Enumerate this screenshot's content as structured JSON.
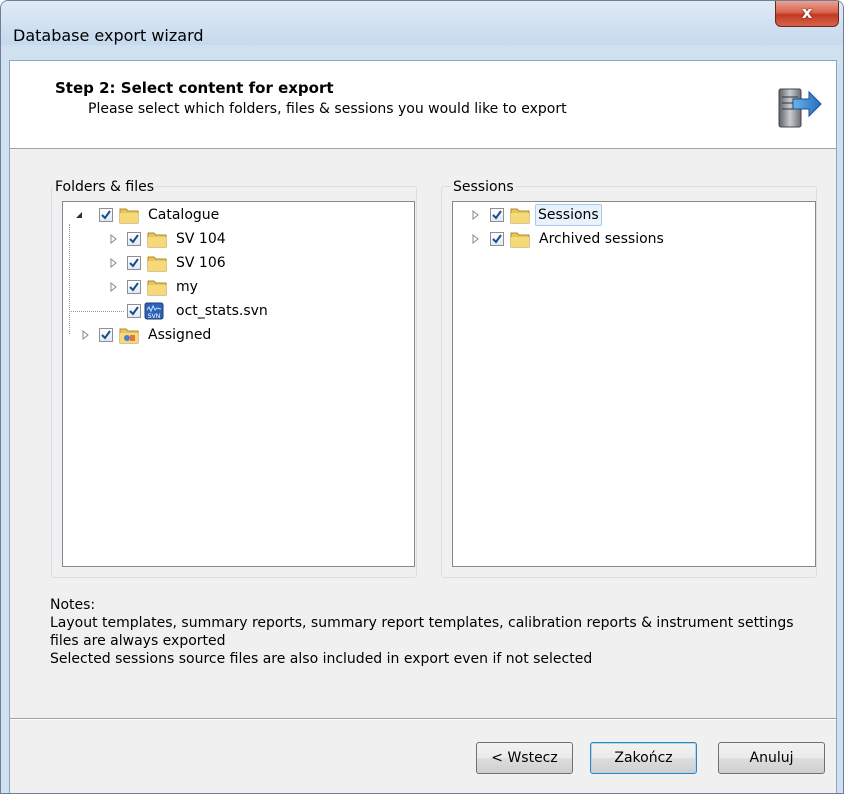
{
  "window": {
    "title": "Database export wizard",
    "close_glyph": "x"
  },
  "header": {
    "title": "Step 2: Select content for export",
    "subtitle": "Please select which folders, files & sessions you would like to export",
    "icon": "export-server-icon"
  },
  "folders_group": {
    "label": "Folders & files",
    "tree": [
      {
        "label": "Catalogue",
        "checked": true,
        "expanded": true,
        "icon": "folder-icon"
      },
      {
        "label": "SV 104",
        "checked": true,
        "expanded": false,
        "icon": "folder-icon"
      },
      {
        "label": "SV 106",
        "checked": true,
        "expanded": false,
        "icon": "folder-icon"
      },
      {
        "label": "my",
        "checked": true,
        "expanded": false,
        "icon": "folder-icon"
      },
      {
        "label": "oct_stats.svn",
        "checked": true,
        "icon": "svn-file-icon"
      },
      {
        "label": "Assigned",
        "checked": true,
        "expanded": false,
        "icon": "shared-folder-icon"
      }
    ]
  },
  "sessions_group": {
    "label": "Sessions",
    "tree": [
      {
        "label": "Sessions",
        "checked": true,
        "expanded": false,
        "selected": true,
        "icon": "folder-icon"
      },
      {
        "label": "Archived sessions",
        "checked": true,
        "expanded": false,
        "icon": "folder-icon"
      }
    ]
  },
  "notes": {
    "heading": "Notes:",
    "line1": "Layout templates, summary reports, summary report templates, calibration reports & instrument settings",
    "line2": "files are always exported",
    "line3": "Selected sessions source files are also included in export even if not selected"
  },
  "buttons": {
    "back": "< Wstecz",
    "finish": "Zakończ",
    "cancel": "Anuluj"
  },
  "colors": {
    "selection": "#e8f2fc",
    "close_red": "#c13a22",
    "check": "#1a4c8c"
  }
}
